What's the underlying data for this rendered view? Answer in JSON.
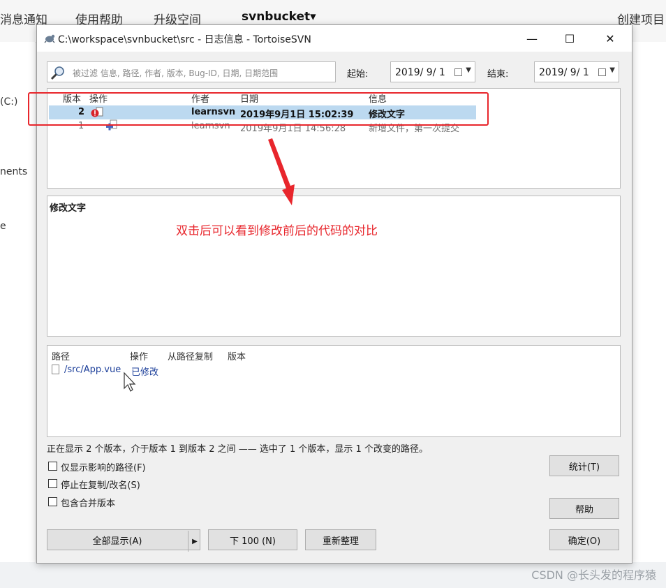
{
  "background_app": {
    "nav": [
      "消息通知",
      "使用帮助",
      "升级空间",
      "svnbucket▾",
      "创建项目"
    ],
    "left_texts": [
      "(C:)",
      "nents",
      "e"
    ]
  },
  "watermark": "CSDN @长头发的程序猿",
  "dialog": {
    "title": "C:\\workspace\\svnbucket\\src - 日志信息 - TortoiseSVN",
    "window_controls": {
      "minimize": "—",
      "maximize": "☐",
      "close": "✕"
    },
    "filter": {
      "placeholder": "被过滤 信息, 路径, 作者, 版本, Bug-ID, 日期, 日期范围"
    },
    "date_from": {
      "label": "起始:",
      "value": "2019/ 9/ 1"
    },
    "date_to": {
      "label": "结束:",
      "value": "2019/ 9/ 1"
    },
    "revision_list": {
      "columns": [
        "版本",
        "操作",
        "作者",
        "日期",
        "信息"
      ],
      "rows": [
        {
          "revision": "2",
          "author": "learnsvn",
          "date": "2019年9月1日 15:02:39",
          "message": "修改文字",
          "selected": true
        },
        {
          "revision": "1",
          "author": "learnsvn",
          "date": "2019年9月1日 14:56:28",
          "message": "新增文件，第一次提交",
          "selected": false
        }
      ]
    },
    "annotation": "双击后可以看到修改前后的代码的对比",
    "message_pane": {
      "text": "修改文字"
    },
    "changed_paths": {
      "columns": [
        "路径",
        "操作",
        "从路径复制",
        "版本"
      ],
      "rows": [
        {
          "path": "/src/App.vue",
          "action": "已修改"
        }
      ]
    },
    "status": "正在显示 2 个版本，介于版本 1 到版本 2 之间 —— 选中了 1 个版本，显示 1 个改变的路径。",
    "checkboxes": [
      {
        "label": "仅显示影响的路径(F)",
        "checked": false
      },
      {
        "label": "停止在复制/改名(S)",
        "checked": false
      },
      {
        "label": "包含合并版本",
        "checked": false
      }
    ],
    "buttons": {
      "show_all": "全部显示(A)",
      "next100": "下 100 (N)",
      "refresh": "重新整理",
      "stats": "统计(T)",
      "help": "帮助",
      "ok": "确定(O)"
    }
  },
  "colors": {
    "annotation_red": "#e8262c",
    "selection_blue": "#bcd9f0"
  }
}
